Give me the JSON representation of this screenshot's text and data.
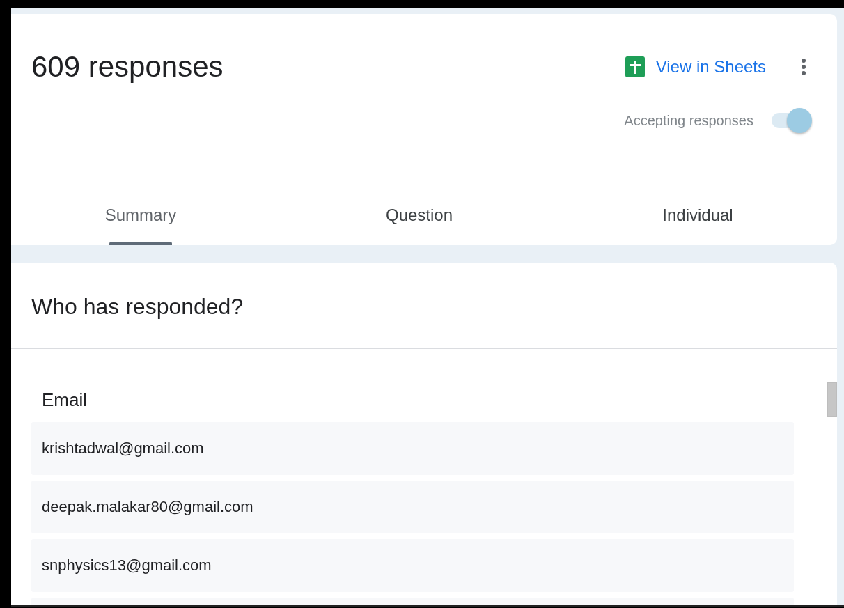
{
  "header": {
    "title": "609 responses",
    "sheets_link": "View in Sheets",
    "accepting": {
      "label": "Accepting responses",
      "on": true
    }
  },
  "tabs": [
    {
      "label": "Summary",
      "selected": true
    },
    {
      "label": "Question",
      "selected": false
    },
    {
      "label": "Individual",
      "selected": false
    }
  ],
  "respondents": {
    "title": "Who has responded?",
    "column": "Email",
    "rows": [
      {
        "email": "krishtadwal@gmail.com"
      },
      {
        "email": "deepak.malakar80@gmail.com"
      },
      {
        "email": "snphysics13@gmail.com"
      }
    ]
  }
}
